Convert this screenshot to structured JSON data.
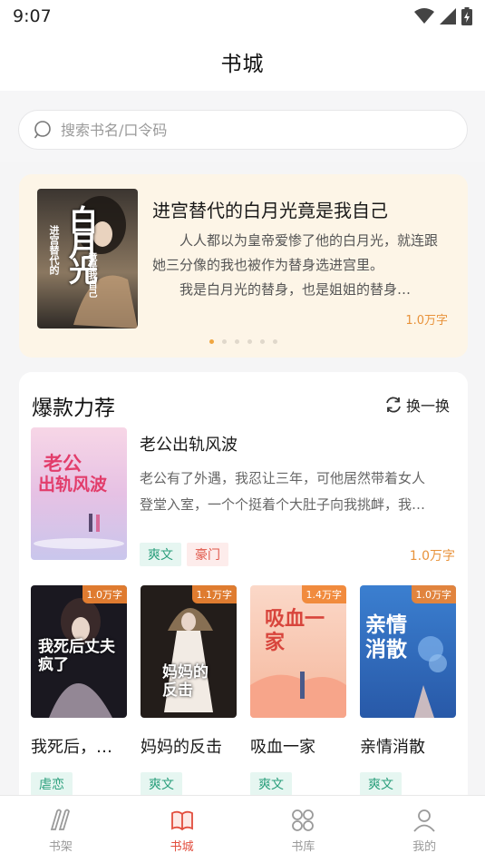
{
  "status_bar": {
    "time": "9:07"
  },
  "header": {
    "title": "书城"
  },
  "search": {
    "placeholder": "搜索书名/口令码"
  },
  "banner": {
    "title": "进宫替代的白月光竟是我自己",
    "desc_line1": "人人都以为皇帝爱惨了他的白月光，就连跟",
    "desc_line2": "她三分像的我也被作为替身选进宫里。",
    "desc_line3": "我是白月光的替身，也是姐姐的替身…",
    "word_count": "1.0万字",
    "cover_text_main": "白月光",
    "cover_text_side": "进宫替代的",
    "cover_text_side2": "竟是我自己",
    "dot_count": 6,
    "active_dot": 0
  },
  "recommend": {
    "title": "爆款力荐",
    "refresh_label": "换一换",
    "featured": {
      "title": "老公出轨风波",
      "desc_line1": "老公有了外遇，我忍让三年，可他居然带着女人",
      "desc_line2": "登堂入室，一个个挺着个大肚子向我挑衅，我…",
      "tags": [
        "爽文",
        "豪门"
      ],
      "word_count": "1.0万字",
      "cover_text_1": "老公",
      "cover_text_2": "出轨风波"
    },
    "books": [
      {
        "title": "我死后，…",
        "word_count": "1.0万字",
        "tag": "虐恋",
        "cover_text": "我死后丈夫疯了"
      },
      {
        "title": "妈妈的反击",
        "word_count": "1.1万字",
        "tag": "爽文",
        "cover_text": "妈妈的反击"
      },
      {
        "title": "吸血一家",
        "word_count": "1.4万字",
        "tag": "爽文",
        "cover_text": "吸血一家"
      },
      {
        "title": "亲情消散",
        "word_count": "1.0万字",
        "tag": "爽文",
        "cover_text": "亲情消散"
      }
    ]
  },
  "tabbar": {
    "items": [
      {
        "label": "书架",
        "icon": "bookshelf-icon"
      },
      {
        "label": "书城",
        "icon": "bookstore-icon"
      },
      {
        "label": "书库",
        "icon": "library-icon"
      },
      {
        "label": "我的",
        "icon": "profile-icon"
      }
    ],
    "active_index": 1
  },
  "colors": {
    "accent": "#e24d3d",
    "word_count": "#e8923a",
    "tag_green": "#2b9f7c",
    "tag_red": "#e0574a"
  }
}
